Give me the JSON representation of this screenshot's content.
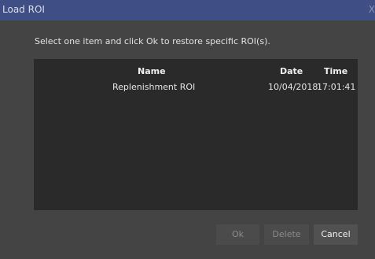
{
  "window": {
    "title": "Load ROI",
    "close_glyph": "X"
  },
  "instruction": "Select one item and click Ok to restore specific ROI(s).",
  "table": {
    "columns": [
      "Name",
      "Date",
      "Time"
    ],
    "rows": [
      {
        "name": "Replenishment ROI",
        "date": "10/04/2018",
        "time": "17:01:41"
      }
    ]
  },
  "buttons": {
    "ok": "Ok",
    "delete": "Delete",
    "cancel": "Cancel"
  },
  "colors": {
    "titlebar": "#3f4f86",
    "dialog_bg": "#444444",
    "list_bg": "#2a2a2a"
  }
}
